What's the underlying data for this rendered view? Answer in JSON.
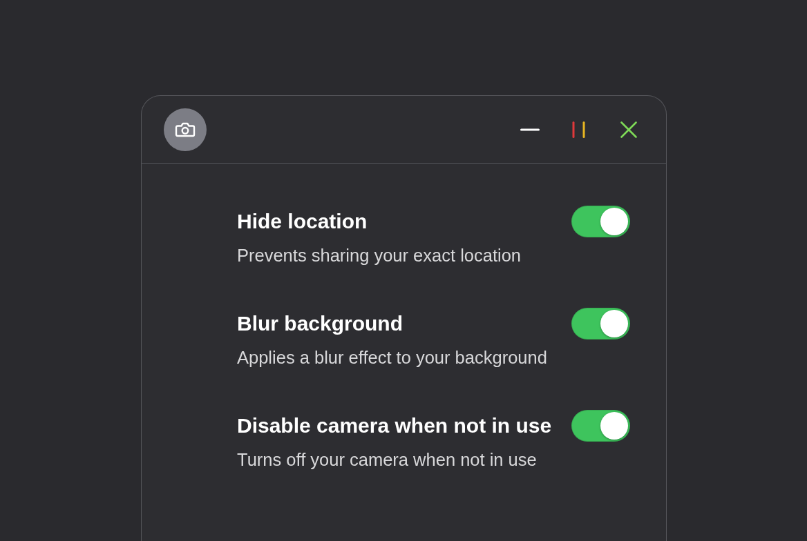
{
  "settings": [
    {
      "title": "Hide location",
      "description": "Prevents sharing your exact location",
      "on": true
    },
    {
      "title": "Blur background",
      "description": "Applies a blur effect to your background",
      "on": true
    },
    {
      "title": "Disable camera when not in use",
      "description": "Turns off your camera when not in use",
      "on": true
    }
  ]
}
